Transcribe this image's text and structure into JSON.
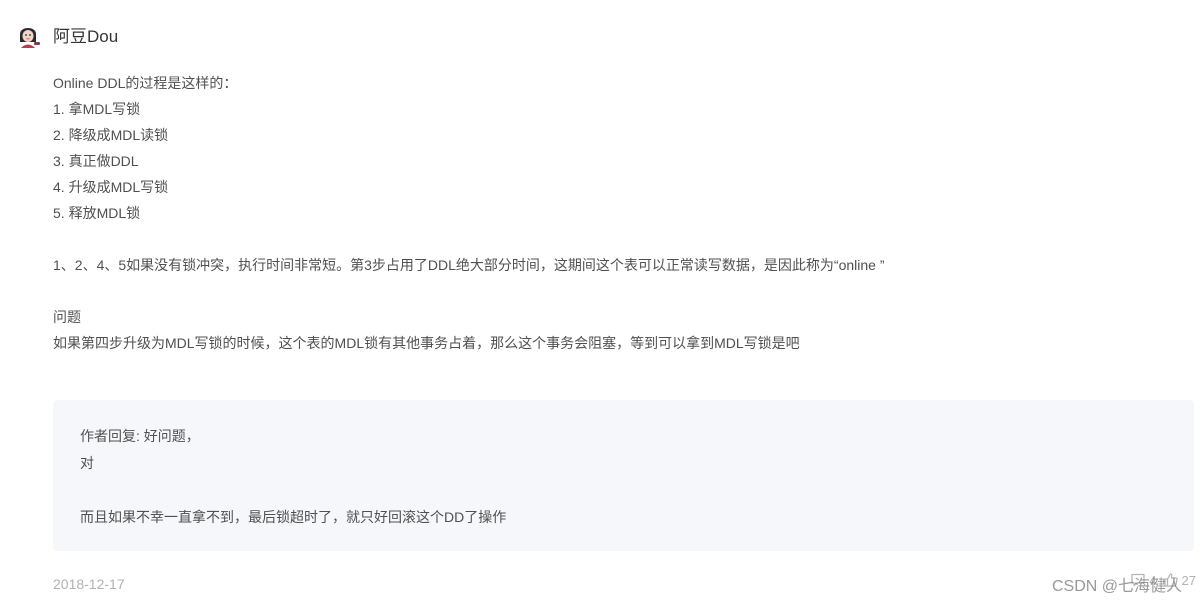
{
  "user": {
    "name": "阿豆Dou",
    "avatar_icon": "avatar-icon"
  },
  "comment": {
    "lines": [
      "Online DDL的过程是这样的：",
      "1. 拿MDL写锁",
      "2. 降级成MDL读锁",
      "3. 真正做DDL",
      "4. 升级成MDL写锁",
      "5. 释放MDL锁",
      "",
      "1、2、4、5如果没有锁冲突，执行时间非常短。第3步占用了DDL绝大部分时间，这期间这个表可以正常读写数据，是因此称为“online ”",
      "",
      "问题",
      "如果第四步升级为MDL写锁的时候，这个表的MDL锁有其他事务占着，那么这个事务会阻塞，等到可以拿到MDL写锁是吧"
    ]
  },
  "reply": {
    "lines": [
      "作者回复: 好问题，",
      "对",
      "",
      "而且如果不幸一直拿不到，最后锁超时了，就只好回滚这个DD了操作"
    ]
  },
  "footer": {
    "date": "2018-12-17",
    "comment_count": "4",
    "like_count": "27",
    "comment_icon": "comment-icon",
    "like_icon": "thumbs-up-icon"
  },
  "watermark": "CSDN @七海健人"
}
